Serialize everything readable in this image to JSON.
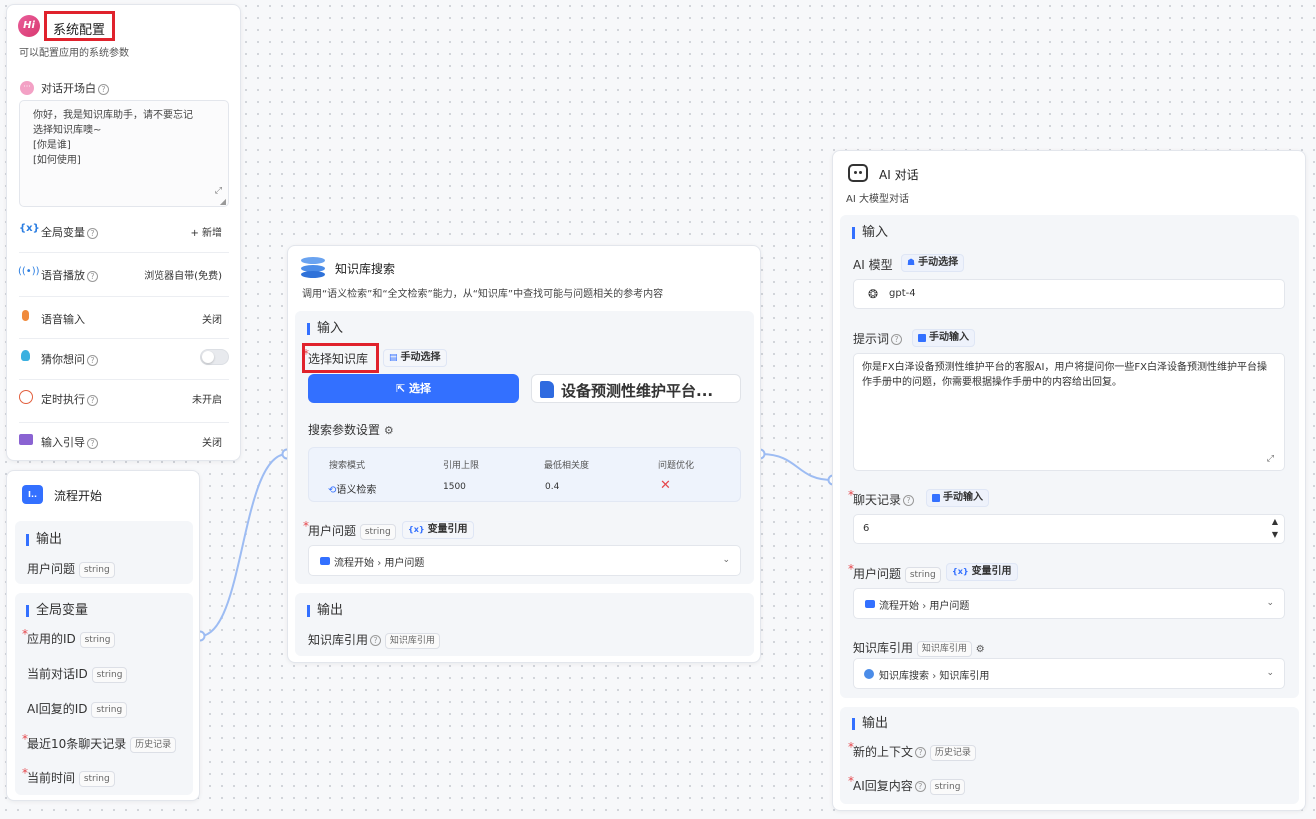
{
  "sys": {
    "logo": "Hi",
    "title": "系统配置",
    "desc": "可以配置应用的系统参数",
    "welcome_label": "对话开场白",
    "welcome_text": "你好，我是知识库助手，请不要忘记\n选择知识库噢~\n[你是谁]\n[如何使用]",
    "rows": [
      {
        "label": "全局变量",
        "value": "+ 新增"
      },
      {
        "label": "语音播放",
        "value": "浏览器自带(免费)"
      },
      {
        "label": "语音输入",
        "value": "关闭"
      },
      {
        "label": "猜你想问",
        "value": ""
      },
      {
        "label": "定时执行",
        "value": "未开启"
      },
      {
        "label": "输入引导",
        "value": "关闭"
      }
    ]
  },
  "start": {
    "title": "流程开始",
    "output_head": "输出",
    "output_item": "用户问题",
    "global_head": "全局变量",
    "globals": [
      {
        "label": "应用的ID",
        "tag": "string",
        "req": "*"
      },
      {
        "label": "当前对话ID",
        "tag": "string",
        "req": ""
      },
      {
        "label": "AI回复的ID",
        "tag": "string",
        "req": ""
      },
      {
        "label": "最近10条聊天记录",
        "tag": "历史记录",
        "req": "*"
      },
      {
        "label": "当前时间",
        "tag": "string",
        "req": "*"
      }
    ]
  },
  "kb": {
    "title": "知识库搜索",
    "desc": "调用“语义检索”和“全文检索”能力，从“知识库”中查找可能与问题相关的参考内容",
    "input_head": "输入",
    "select_label": "选择知识库",
    "manual": "手动选择",
    "select_btn": "选择",
    "kb_name": "设备预测性维护平台...",
    "params_label": "搜索参数设置",
    "table_headers": [
      "搜索模式",
      "引用上限",
      "最低相关度",
      "问题优化"
    ],
    "table_row": [
      "语义检索",
      "1500",
      "0.4",
      "✕"
    ],
    "question_label": "用户问题",
    "var_ref": "变量引用",
    "question_value_a": "流程开始",
    "question_value_b": "用户问题",
    "output_head": "输出",
    "output_item": "知识库引用",
    "output_tag": "知识库引用"
  },
  "ai": {
    "title": "AI 对话",
    "desc": "AI 大模型对话",
    "input_head": "输入",
    "model_label": "AI 模型",
    "manual_select": "手动选择",
    "model_value": "gpt-4",
    "prompt_label": "提示词",
    "manual_input": "手动输入",
    "prompt_text": "你是FX白泽设备预测性维护平台的客服AI，用户将提问你一些FX白泽设备预测性维护平台操作手册中的问题，你需要根据操作手册中的内容给出回复。",
    "history_label": "聊天记录",
    "history_value": "6",
    "question_label": "用户问题",
    "var_ref": "变量引用",
    "question_value_a": "流程开始",
    "question_value_b": "用户问题",
    "kbref_label": "知识库引用",
    "kbref_value_a": "知识库搜索",
    "kbref_value_b": "知识库引用",
    "output_head": "输出",
    "out1": "新的上下文",
    "out1_tag": "历史记录",
    "out2": "AI回复内容",
    "out2_tag": "string"
  },
  "common": {
    "string": "string",
    "required_mark": "*",
    "sep": "›"
  }
}
